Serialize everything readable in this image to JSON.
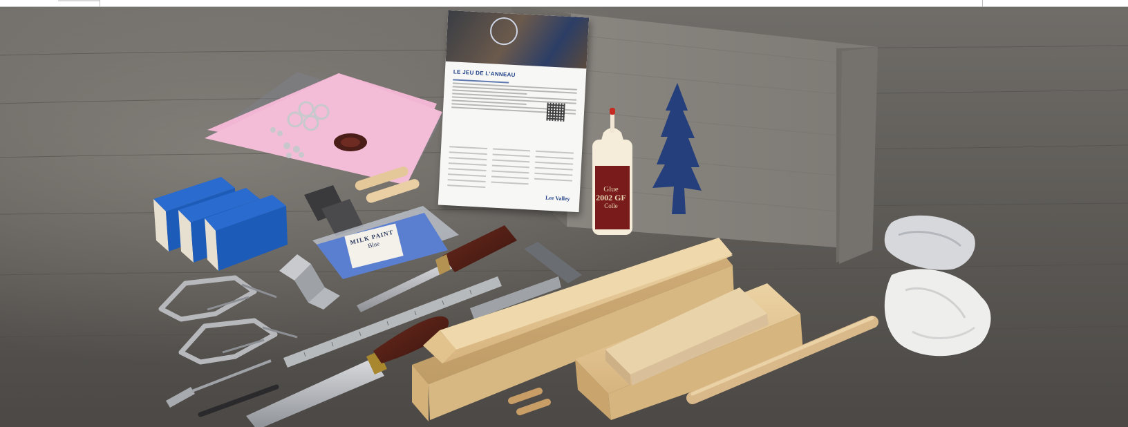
{
  "card": {
    "title": "LE JEU DE L'ANNEAU",
    "brand": "Lee Valley"
  },
  "glue": {
    "line1": "Glue",
    "line2": "2002 GF",
    "line3": "Colle"
  },
  "packet": {
    "line1": "MILK PAINT",
    "line2": "Blue"
  },
  "colors": {
    "wood_table": "#5e5b57",
    "box_cardboard": "#8f8b85",
    "tree_blue": "#253f7c",
    "sanding_blue": "#1d5bb8",
    "pink_sheet": "#f1b6d3",
    "pine": "#e6c795"
  },
  "icons": [
    "pine-tree-icon",
    "qr-code-icon",
    "brand-logo-icon"
  ]
}
